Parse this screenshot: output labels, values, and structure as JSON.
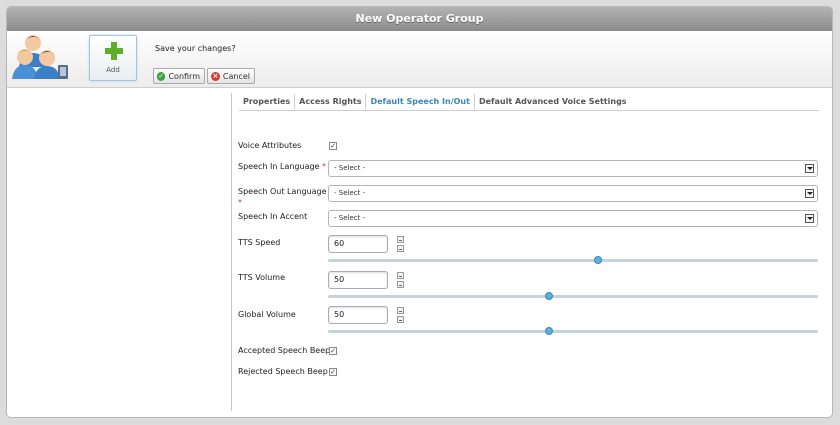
{
  "window": {
    "title": "New Operator Group"
  },
  "toolbar": {
    "add_label": "Add",
    "save_prompt": "Save your changes?",
    "confirm_label": "Confirm",
    "cancel_label": "Cancel"
  },
  "tabs": [
    {
      "label": "Properties",
      "active": false
    },
    {
      "label": "Access Rights",
      "active": false
    },
    {
      "label": "Default Speech In/Out",
      "active": true
    },
    {
      "label": "Default Advanced Voice Settings",
      "active": false
    }
  ],
  "form": {
    "voice_attributes": {
      "label": "Voice Attributes",
      "checked": true
    },
    "speech_in_language": {
      "label": "Speech In Language",
      "required": "*",
      "value": "- Select -"
    },
    "speech_out_language": {
      "label": "Speech Out Language",
      "required": "*",
      "value": "- Select -"
    },
    "speech_in_accent": {
      "label": "Speech In Accent",
      "value": "- Select -"
    },
    "tts_speed": {
      "label": "TTS Speed",
      "value": "60",
      "slider_fraction": 0.55
    },
    "tts_volume": {
      "label": "TTS Volume",
      "value": "50",
      "slider_fraction": 0.45
    },
    "global_volume": {
      "label": "Global Volume",
      "value": "50",
      "slider_fraction": 0.45
    },
    "accepted_speech_beep": {
      "label": "Accepted Speech Beep",
      "checked": true
    },
    "rejected_speech_beep": {
      "label": "Rejected Speech Beep",
      "checked": true
    }
  },
  "colors": {
    "accent": "#3a88b7",
    "confirm": "#3aa33a",
    "cancel": "#d43b2f",
    "slider_handle": "#5ab0dc"
  }
}
